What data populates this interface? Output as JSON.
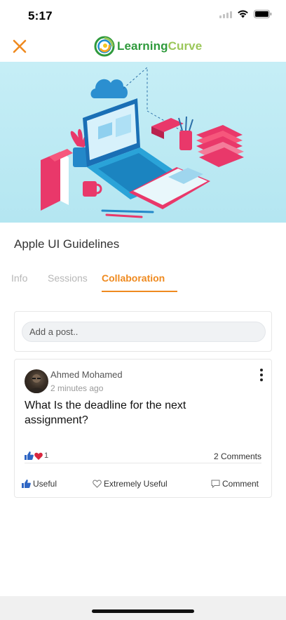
{
  "status_bar": {
    "time": "5:17"
  },
  "header": {
    "brand_part1": "Learning",
    "brand_part2": "Curve",
    "icons": {
      "close": "close-icon",
      "logo": "learningcurve-logo-icon"
    },
    "colors": {
      "accent": "#ef8a1f",
      "brand_dark": "#2f9a3c",
      "brand_light": "#9bc75a"
    }
  },
  "course": {
    "title": "Apple UI Guidelines"
  },
  "tabs": [
    {
      "label": "Info",
      "active": false
    },
    {
      "label": "Sessions",
      "active": false
    },
    {
      "label": "Collaboration",
      "active": true
    }
  ],
  "add_post": {
    "placeholder": "Add a post.."
  },
  "post": {
    "author": "Ahmed Mohamed",
    "time": "2 minutes ago",
    "text": "What Is the deadline for the next assignment?",
    "reaction_count": "1",
    "comments_label": "2 Comments",
    "actions": {
      "useful": "Useful",
      "extremely_useful": "Extremely Useful",
      "comment": "Comment"
    }
  }
}
